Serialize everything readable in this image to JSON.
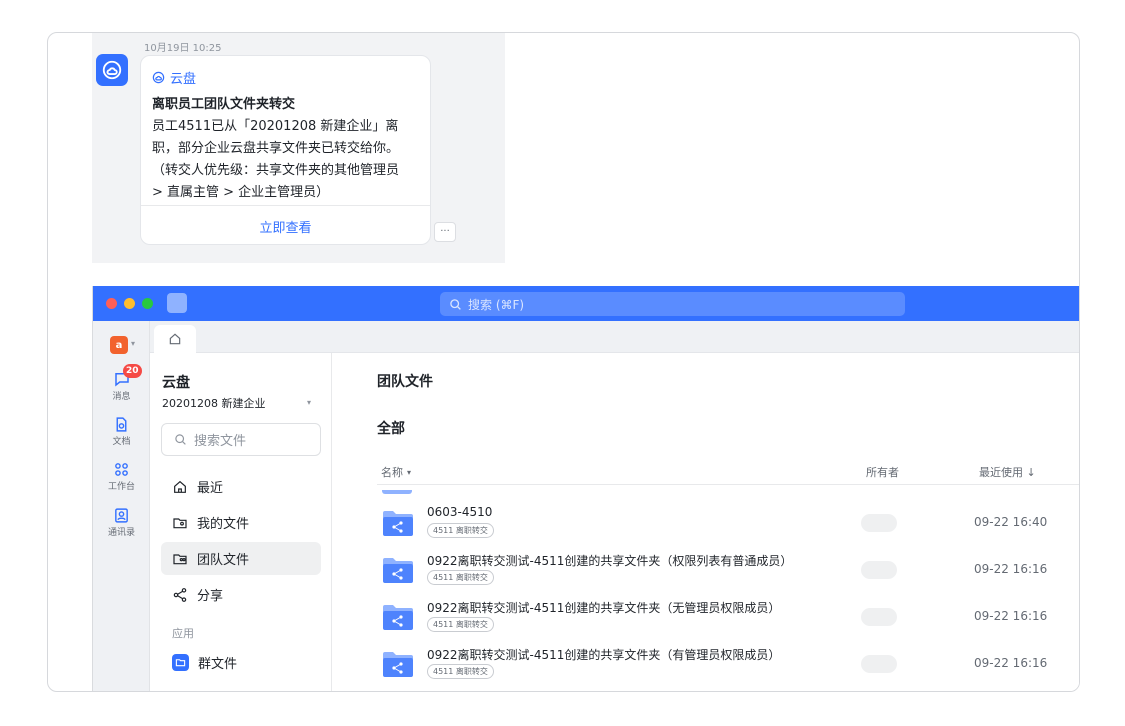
{
  "chat": {
    "timestamp": "10月19日 10:25",
    "card": {
      "app_name": "云盘",
      "title": "离职员工团队文件夹转交",
      "body_lines": [
        "员工4511已从「20201208 新建企业」离",
        "职，部分企业云盘共享文件夹已转交给你。",
        "（转交人优先级：共享文件夹的其他管理员",
        "> 直属主管 > 企业主管理员）"
      ],
      "action": "立即查看"
    },
    "more": "···"
  },
  "window": {
    "search_placeholder": "搜索 (⌘F)",
    "tenant_badge": "a",
    "nav": [
      {
        "label": "消息",
        "icon": "chat-icon",
        "badge": "20"
      },
      {
        "label": "文档",
        "icon": "document-icon"
      },
      {
        "label": "工作台",
        "icon": "workspace-icon"
      },
      {
        "label": "通讯录",
        "icon": "contacts-icon"
      }
    ],
    "sidebar": {
      "title": "云盘",
      "org": "20201208 新建企业",
      "search_placeholder": "搜索文件",
      "items": [
        {
          "label": "最近",
          "icon": "home-icon"
        },
        {
          "label": "我的文件",
          "icon": "my-files-icon"
        },
        {
          "label": "团队文件",
          "icon": "team-files-icon",
          "active": true
        },
        {
          "label": "分享",
          "icon": "share-icon"
        }
      ],
      "section_label": "应用",
      "app_item": {
        "label": "群文件",
        "icon": "group-files-icon"
      }
    },
    "main": {
      "title": "团队文件",
      "subtitle": "全部",
      "columns": {
        "name": "名称",
        "owner": "所有者",
        "recent": "最近使用 ↓"
      },
      "rows": [
        {
          "name": "0603-4510",
          "tag": "4511 离职转交",
          "time": "09-22 16:40"
        },
        {
          "name": "0922离职转交测试-4511创建的共享文件夹（权限列表有普通成员）",
          "tag": "4511 离职转交",
          "time": "09-22 16:16"
        },
        {
          "name": "0922离职转交测试-4511创建的共享文件夹（无管理员权限成员）",
          "tag": "4511 离职转交",
          "time": "09-22 16:16"
        },
        {
          "name": "0922离职转交测试-4511创建的共享文件夹（有管理员权限成员）",
          "tag": "4511 离职转交",
          "time": "09-22 16:16"
        }
      ]
    }
  },
  "colors": {
    "accent": "#3370ff",
    "badge": "#f54a45",
    "tenant": "#f2622d"
  }
}
